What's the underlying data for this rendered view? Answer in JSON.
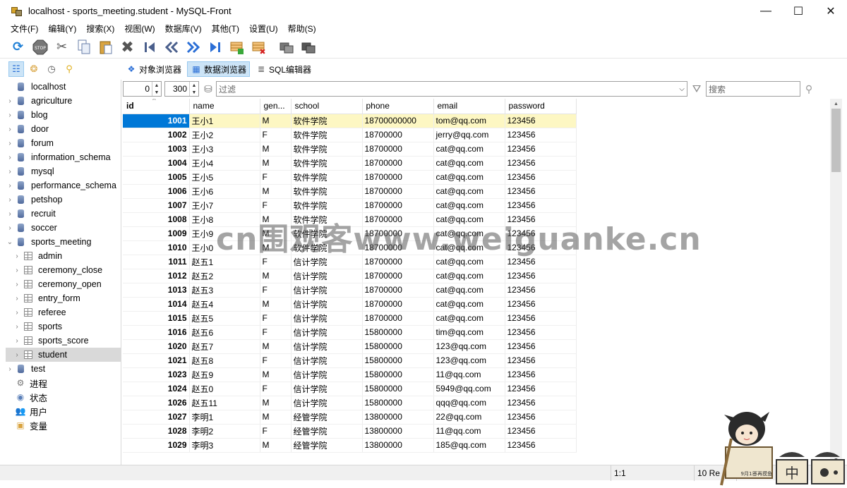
{
  "window": {
    "title": "localhost - sports_meeting.student - MySQL-Front",
    "controls": [
      "—",
      "☐",
      "✕"
    ]
  },
  "menu": [
    "文件(F)",
    "编辑(Y)",
    "搜索(X)",
    "视图(W)",
    "数据库(V)",
    "其他(T)",
    "设置(U)",
    "帮助(S)"
  ],
  "toolbar": {
    "icons": [
      "refresh-icon",
      "stop-icon",
      "cut-icon",
      "copy-icon",
      "paste-icon",
      "delete-icon",
      "first-record-icon",
      "previous-record-icon",
      "next-record-icon",
      "last-record-icon",
      "insert-record-icon",
      "delete-record-icon",
      "commit-icon",
      "rollback-icon"
    ]
  },
  "view_tabs": [
    {
      "label": "对象浏览器",
      "active": false
    },
    {
      "label": "数据浏览器",
      "active": true
    },
    {
      "label": "SQL编辑器",
      "active": false
    }
  ],
  "tree": {
    "root": "localhost",
    "databases": [
      "agriculture",
      "blog",
      "door",
      "forum",
      "information_schema",
      "mysql",
      "performance_schema",
      "petshop",
      "recruit",
      "soccer"
    ],
    "expanded_db": "sports_meeting",
    "tables": [
      "admin",
      "ceremony_close",
      "ceremony_open",
      "entry_form",
      "referee",
      "sports",
      "sports_score",
      "student"
    ],
    "selected_table": "student",
    "after": [
      "test"
    ],
    "misc": [
      "进程",
      "状态",
      "用户",
      "变量"
    ]
  },
  "filter": {
    "offset": "0",
    "limit": "300",
    "filter_placeholder": "过滤",
    "search_placeholder": "搜索"
  },
  "grid": {
    "columns": [
      "id",
      "name",
      "gen...",
      "school",
      "phone",
      "email",
      "password"
    ],
    "rows": [
      [
        "1001",
        "王小1",
        "M",
        "软件学院",
        "18700000000",
        "tom@qq.com",
        "123456"
      ],
      [
        "1002",
        "王小2",
        "F",
        "软件学院",
        "18700000",
        "jerry@qq.com",
        "123456"
      ],
      [
        "1003",
        "王小3",
        "M",
        "软件学院",
        "18700000",
        "cat@qq.com",
        "123456"
      ],
      [
        "1004",
        "王小4",
        "M",
        "软件学院",
        "18700000",
        "cat@qq.com",
        "123456"
      ],
      [
        "1005",
        "王小5",
        "F",
        "软件学院",
        "18700000",
        "cat@qq.com",
        "123456"
      ],
      [
        "1006",
        "王小6",
        "M",
        "软件学院",
        "18700000",
        "cat@qq.com",
        "123456"
      ],
      [
        "1007",
        "王小7",
        "F",
        "软件学院",
        "18700000",
        "cat@qq.com",
        "123456"
      ],
      [
        "1008",
        "王小8",
        "M",
        "软件学院",
        "18700000",
        "cat@qq.com",
        "123456"
      ],
      [
        "1009",
        "王小9",
        "M",
        "软件学院",
        "18700000",
        "cat@qq.com",
        "123456"
      ],
      [
        "1010",
        "王小0",
        "M",
        "软件学院",
        "18700000",
        "cat@qq.com",
        "123456"
      ],
      [
        "1011",
        "赵五1",
        "F",
        "信计学院",
        "18700000",
        "cat@qq.com",
        "123456"
      ],
      [
        "1012",
        "赵五2",
        "M",
        "信计学院",
        "18700000",
        "cat@qq.com",
        "123456"
      ],
      [
        "1013",
        "赵五3",
        "F",
        "信计学院",
        "18700000",
        "cat@qq.com",
        "123456"
      ],
      [
        "1014",
        "赵五4",
        "M",
        "信计学院",
        "18700000",
        "cat@qq.com",
        "123456"
      ],
      [
        "1015",
        "赵五5",
        "F",
        "信计学院",
        "18700000",
        "cat@qq.com",
        "123456"
      ],
      [
        "1016",
        "赵五6",
        "F",
        "信计学院",
        "15800000",
        "tim@qq.com",
        "123456"
      ],
      [
        "1020",
        "赵五7",
        "M",
        "信计学院",
        "15800000",
        "123@qq.com",
        "123456"
      ],
      [
        "1021",
        "赵五8",
        "F",
        "信计学院",
        "15800000",
        "123@qq.com",
        "123456"
      ],
      [
        "1023",
        "赵五9",
        "M",
        "信计学院",
        "15800000",
        "11@qq.com",
        "123456"
      ],
      [
        "1024",
        "赵五0",
        "F",
        "信计学院",
        "15800000",
        "5949@qq.com",
        "123456"
      ],
      [
        "1026",
        "赵五11",
        "M",
        "信计学院",
        "15800000",
        "qqq@qq.com",
        "123456"
      ],
      [
        "1027",
        "李明1",
        "M",
        "经管学院",
        "13800000",
        "22@qq.com",
        "123456"
      ],
      [
        "1028",
        "李明2",
        "F",
        "经管学院",
        "13800000",
        "11@qq.com",
        "123456"
      ],
      [
        "1029",
        "李明3",
        "M",
        "经管学院",
        "13800000",
        "185@qq.com",
        "123456"
      ]
    ],
    "selected_row": 0
  },
  "status": {
    "position": "1:1",
    "records": "10 Re"
  },
  "watermark": "cn围观客www.weiguanke.cn",
  "sticker": {
    "text1": "9月1日",
    "text2": "不再摸鱼"
  },
  "colors": {
    "selection_blue": "#0078d7",
    "selected_row": "#fdf7c3",
    "tab_active": "#cce4f7"
  }
}
